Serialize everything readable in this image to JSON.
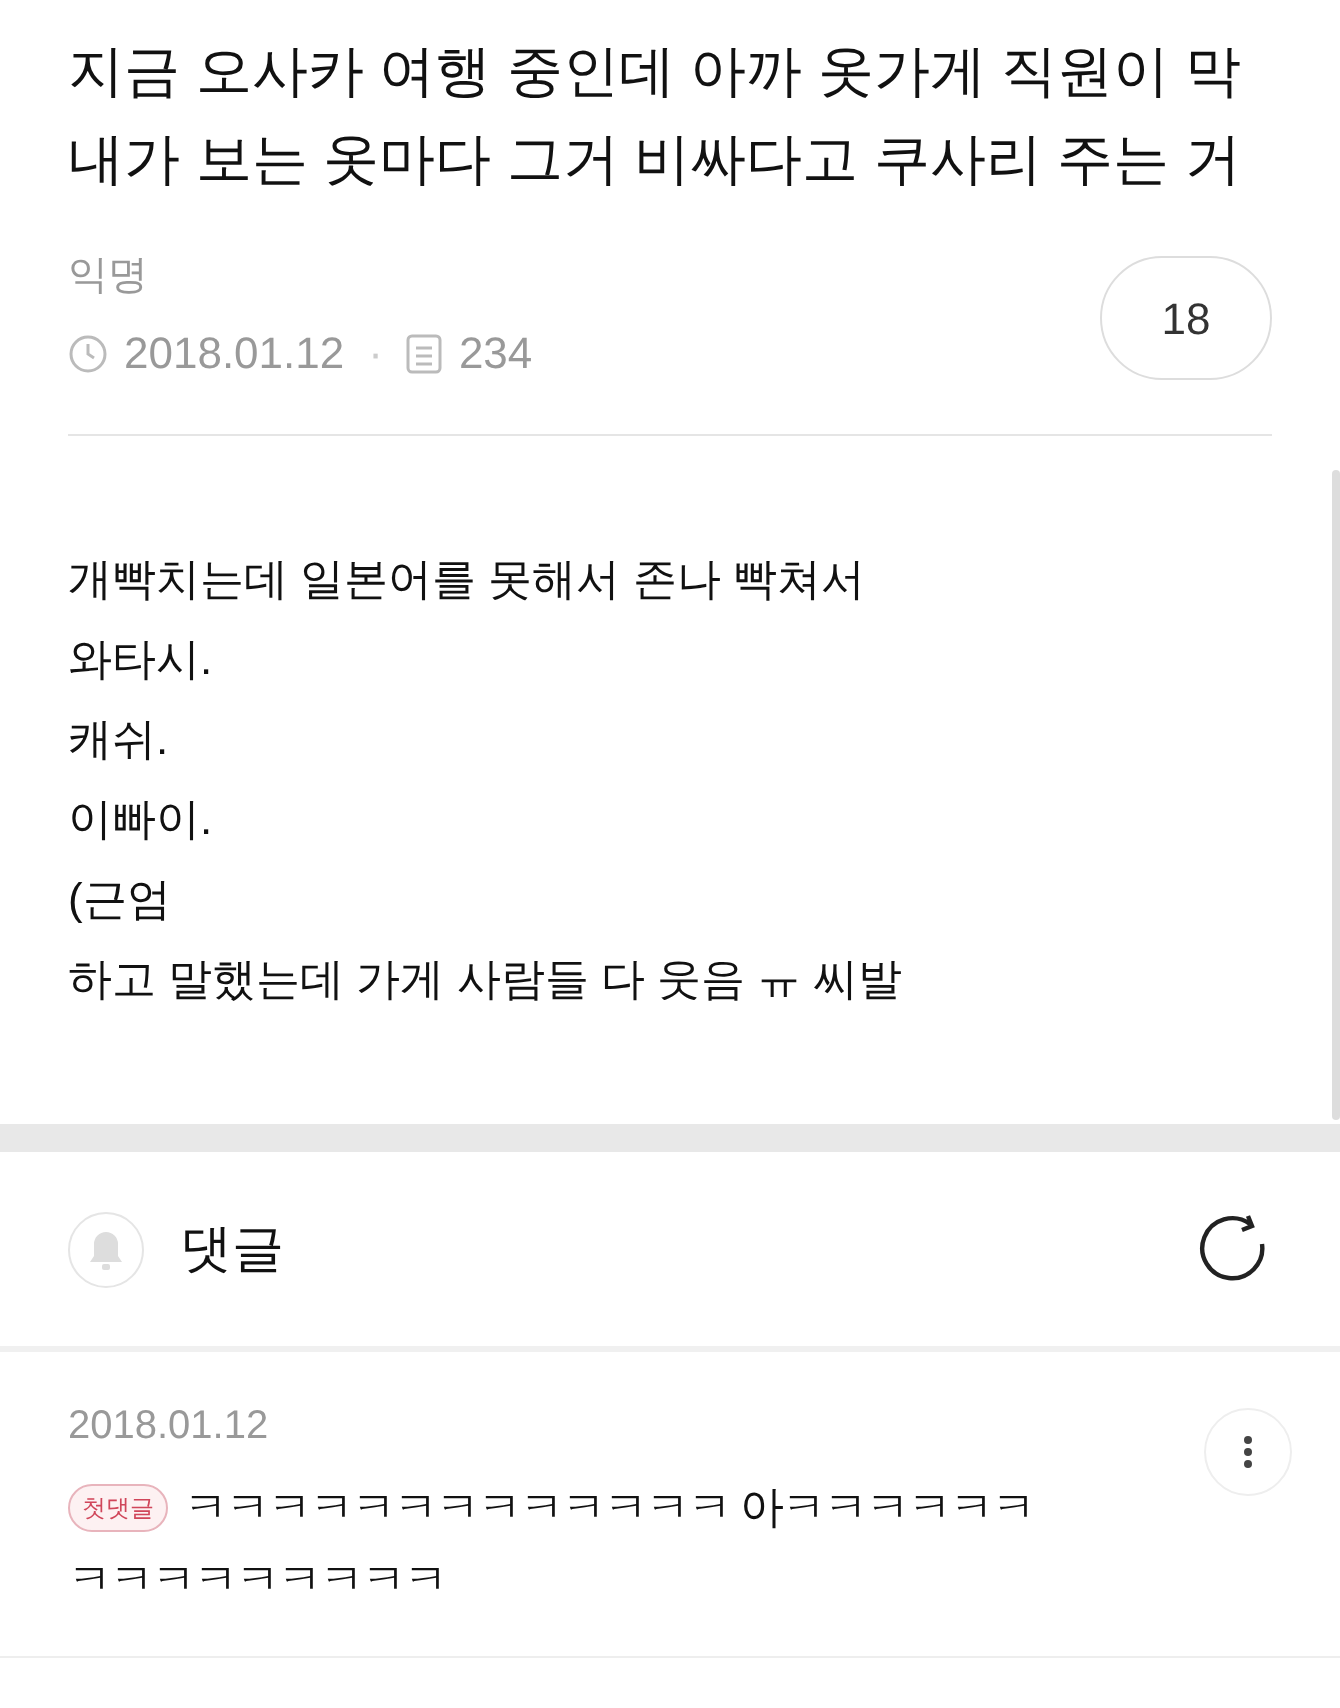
{
  "post": {
    "title_lines": [
      "지금 오사카 여행 중인데 아까 옷가게 직원이 막",
      "내가 보는 옷마다 그거 비싸다고 쿠사리 주는 거"
    ],
    "author": "익명",
    "date": "2018.01.12",
    "separator": "·",
    "views": "234",
    "comment_count": "18",
    "body_lines": [
      "개빡치는데 일본어를 못해서 존나 빡쳐서",
      "와타시.",
      "캐쉬.",
      "이빠이.",
      "(근엄",
      "하고 말했는데 가게 사람들 다 웃음 ㅠ 씨발"
    ]
  },
  "comments_section": {
    "title": "댓글",
    "comments": [
      {
        "date": "2018.01.12",
        "badge": "첫댓글",
        "text_lines": [
          "ㅋㅋㅋㅋㅋㅋㅋㅋㅋㅋㅋㅋㅋ 아ㅋㅋㅋㅋㅋㅋ",
          "ㅋㅋㅋㅋㅋㅋㅋㅋㅋ"
        ]
      }
    ]
  }
}
